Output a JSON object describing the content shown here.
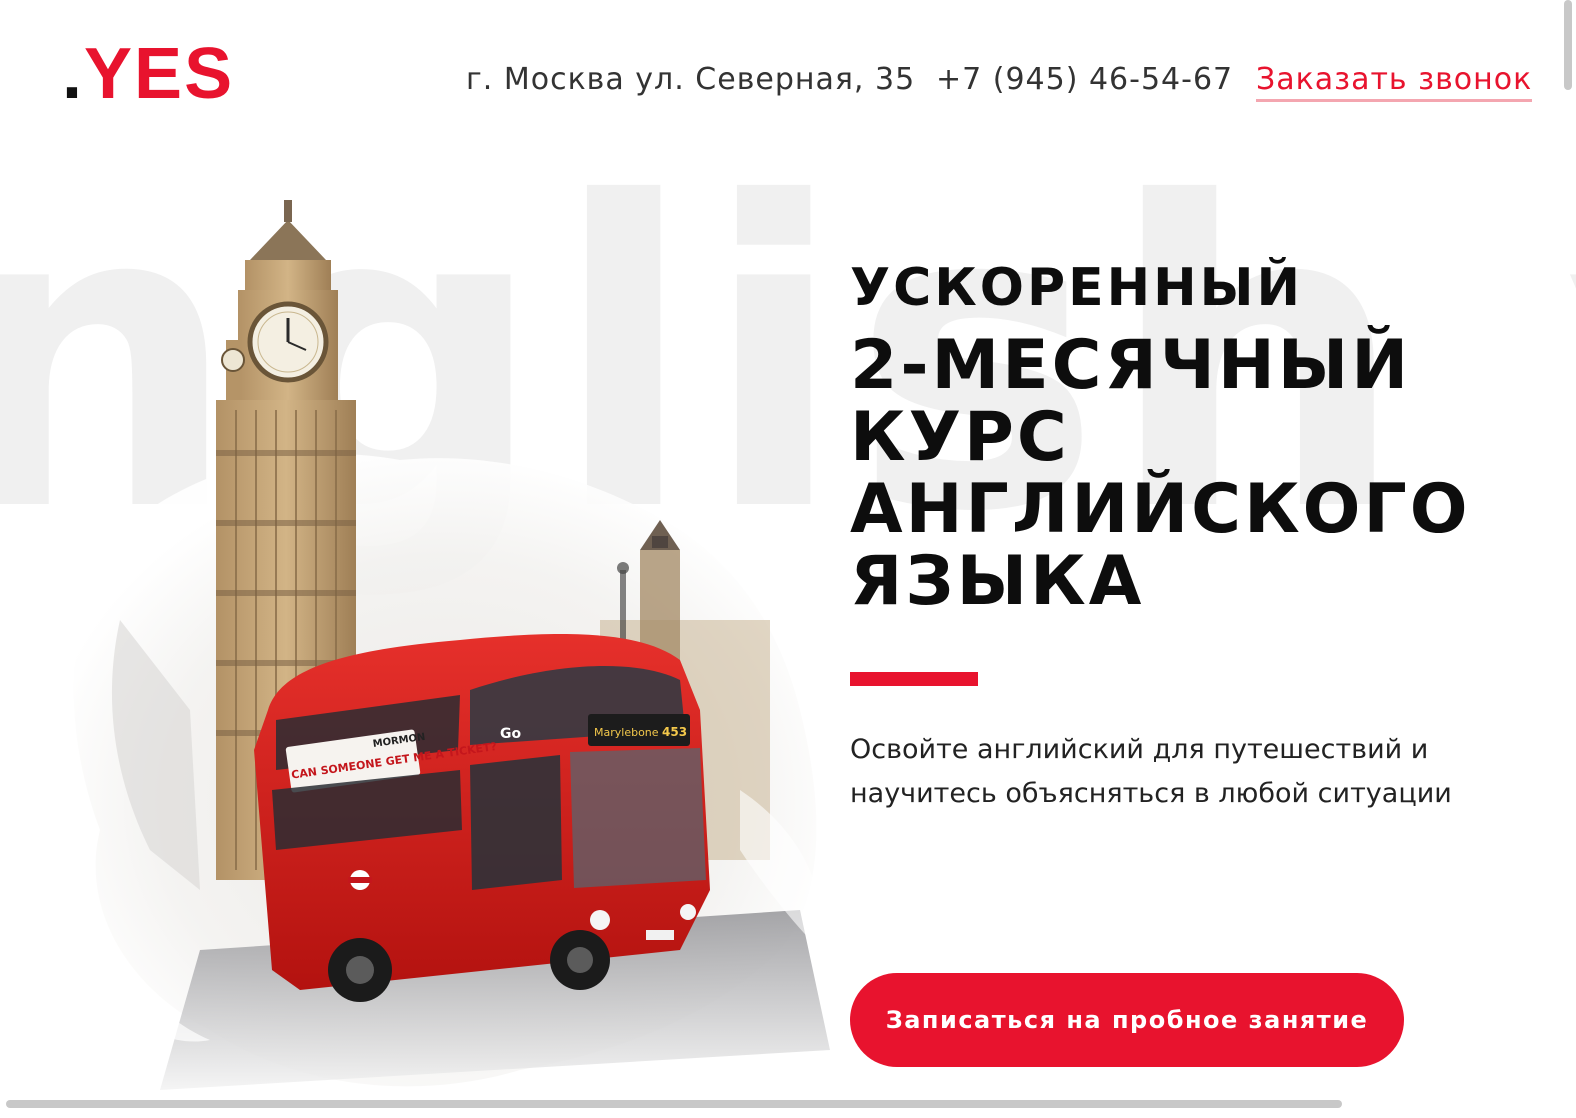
{
  "brand": {
    "logo_dot": ".",
    "logo_text": "YES",
    "accent_color": "#e8132e"
  },
  "header": {
    "address": "г. Москва ул. Северная, 35",
    "phone": "+7 (945) 46-54-67",
    "callback_link": "Заказать звонок"
  },
  "background": {
    "watermark_text": "nglish ye"
  },
  "hero": {
    "title_small": "УСКОРЕННЫЙ",
    "title_lines": [
      "2-МЕСЯЧНЫЙ",
      "КУРС",
      "АНГЛИЙСКОГО",
      "ЯЗЫКА"
    ],
    "subtitle": "Освойте английский для путешествий и научитесь объясняться в любой ситуации",
    "cta_label": "Записаться на пробное занятие",
    "bus_ad_text": "CAN SOMEONE GET ME A TICKET?",
    "bus_ad_brand": "MORMON",
    "bus_route_text": "Marylebone",
    "bus_route_number": "453",
    "bus_logo": "Go"
  }
}
